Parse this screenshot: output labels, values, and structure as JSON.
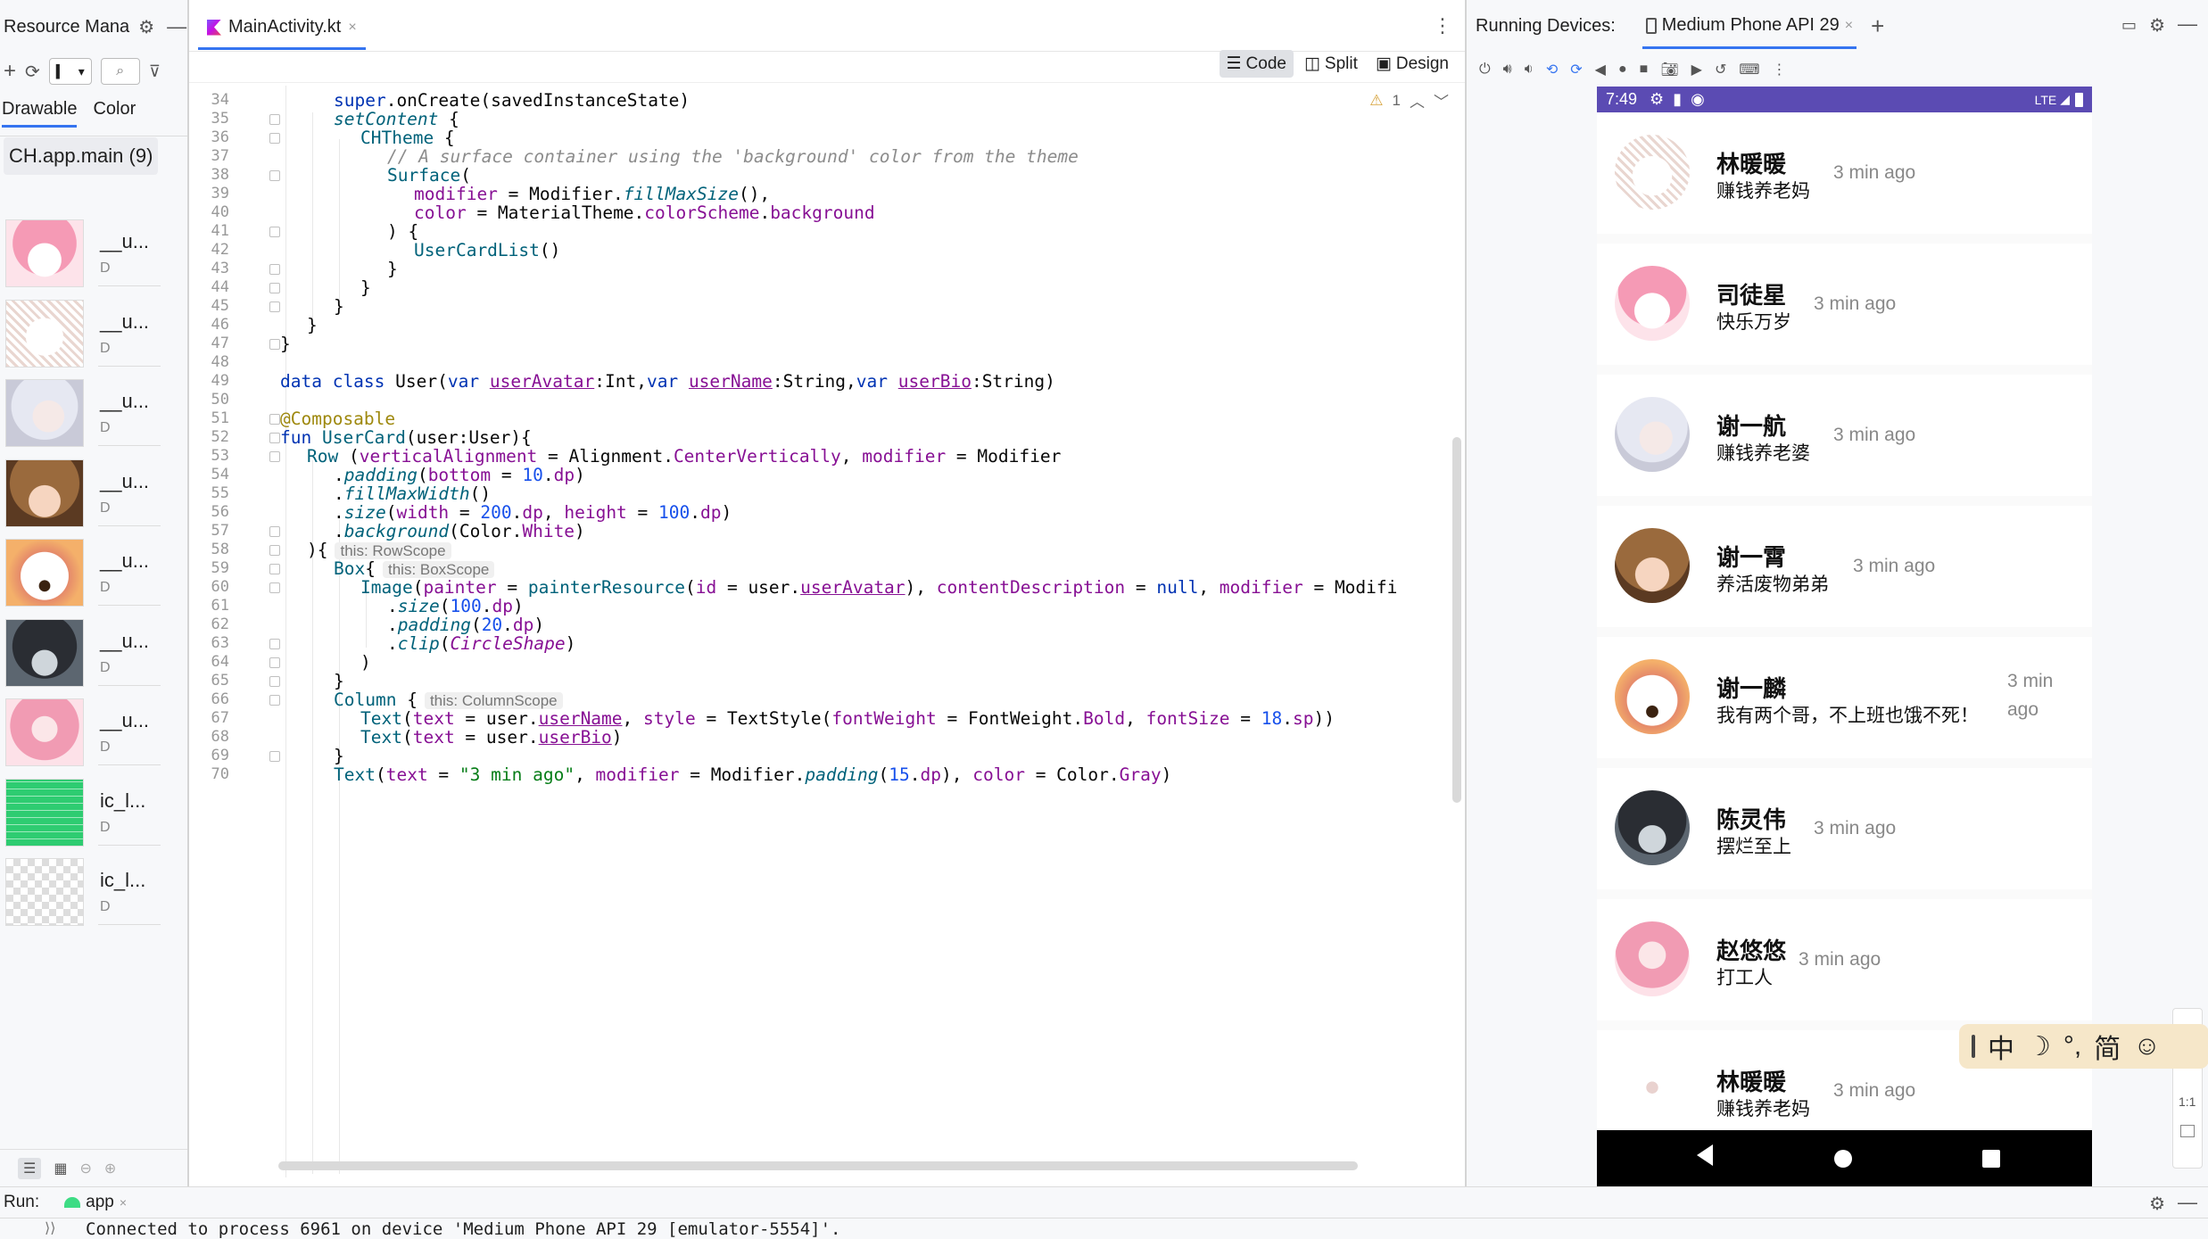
{
  "left_panel": {
    "title": "Resource Mana",
    "tabs": [
      "Drawable",
      "Color"
    ],
    "module": "CH.app.main (9)",
    "items": [
      {
        "name": "__u...",
        "sub": "D",
        "thumb": "pink-girl"
      },
      {
        "name": "__u...",
        "sub": "D",
        "thumb": "sketch-cat"
      },
      {
        "name": "__u...",
        "sub": "D",
        "thumb": "white-hair"
      },
      {
        "name": "__u...",
        "sub": "D",
        "thumb": "brown-hair"
      },
      {
        "name": "__u...",
        "sub": "D",
        "thumb": "white-blob"
      },
      {
        "name": "__u...",
        "sub": "D",
        "thumb": "dark-hair"
      },
      {
        "name": "__u...",
        "sub": "D",
        "thumb": "pink-long-hair"
      },
      {
        "name": "ic_l...",
        "sub": "D",
        "thumb": "green-grid"
      },
      {
        "name": "ic_l...",
        "sub": "D",
        "thumb": "checker"
      }
    ]
  },
  "editor": {
    "tab_label": "MainActivity.kt",
    "view_modes": [
      "Code",
      "Split",
      "Design"
    ],
    "warning_count": "1",
    "line_numbers": [
      "34",
      "35",
      "36",
      "37",
      "38",
      "39",
      "40",
      "41",
      "42",
      "43",
      "44",
      "45",
      "46",
      "47",
      "48",
      "49",
      "50",
      "51",
      "52",
      "53",
      "54",
      "55",
      "56",
      "57",
      "58",
      "59",
      "60",
      "61",
      "62",
      "63",
      "64",
      "65",
      "66",
      "67",
      "68",
      "69",
      "70"
    ],
    "hints": {
      "row": "this: RowScope",
      "box": "this: BoxScope",
      "column": "this: ColumnScope"
    }
  },
  "devices": {
    "title": "Running Devices:",
    "device_tab": "Medium Phone API 29",
    "zoom_label": "1:1"
  },
  "phone": {
    "time": "7:49",
    "network": "LTE",
    "users": [
      {
        "name": "林暖暖",
        "bio": "赚钱养老妈",
        "time": "3 min ago",
        "avatar": "sketch-cat"
      },
      {
        "name": "司徒星",
        "bio": "快乐万岁",
        "time": "3 min ago",
        "avatar": "pink-girl"
      },
      {
        "name": "谢一航",
        "bio": "赚钱养老婆",
        "time": "3 min ago",
        "avatar": "white-hair"
      },
      {
        "name": "谢一霄",
        "bio": "养活废物弟弟",
        "time": "3 min ago",
        "avatar": "brown-hair"
      },
      {
        "name": "谢一麟",
        "bio": "我有两个哥，不上班也饿不死！",
        "time1": "3 min",
        "time2": "ago",
        "avatar": "white-blob"
      },
      {
        "name": "陈灵伟",
        "bio": "摆烂至上",
        "time": "3 min ago",
        "avatar": "dark-hair"
      },
      {
        "name": "赵悠悠",
        "bio": "打工人",
        "time": "3 min ago",
        "avatar": "pink-long-hair"
      },
      {
        "name": "林暖暖",
        "bio": "赚钱养老妈",
        "time": "3 min ago",
        "avatar": "sketch-cat-small"
      }
    ]
  },
  "ime": {
    "items": [
      "中",
      "☽",
      "°,",
      "简",
      "☺"
    ]
  },
  "run": {
    "label": "Run:",
    "config": "app",
    "console": "Connected to process 6961 on device 'Medium Phone API 29 [emulator-5554]'."
  },
  "colors": {
    "accent": "#3574f0",
    "statusbar": "#5b4bb3",
    "keyword": "#0033b3",
    "param": "#871094"
  }
}
